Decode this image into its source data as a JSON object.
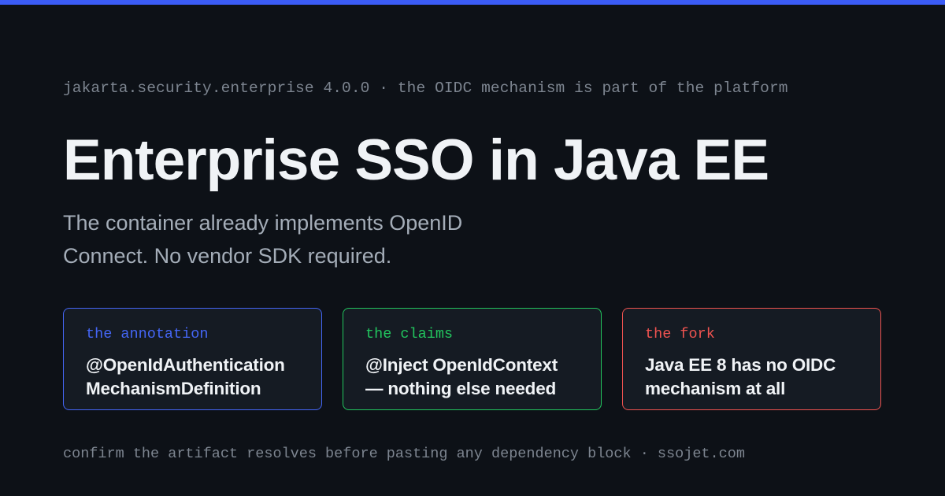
{
  "eyebrow": "jakarta.security.enterprise 4.0.0 · the OIDC mechanism is part of the platform",
  "title": "Enterprise SSO in Java EE",
  "subtitle": "The container already implements OpenID Connect. No vendor SDK required.",
  "cards": [
    {
      "label": "the annotation",
      "text": "@OpenIdAuthentication\nMechanismDefinition",
      "accent": "#4466f5"
    },
    {
      "label": "the claims",
      "text": "@Inject OpenIdContext\n— nothing else needed",
      "accent": "#22c55e"
    },
    {
      "label": "the fork",
      "text": "Java EE 8 has no OIDC\nmechanism at all",
      "accent": "#ef5350"
    }
  ],
  "footer": "confirm the artifact resolves before pasting any dependency block · ssojet.com",
  "colors": {
    "background": "#0d1117",
    "top_bar": "#3b5cf6"
  }
}
